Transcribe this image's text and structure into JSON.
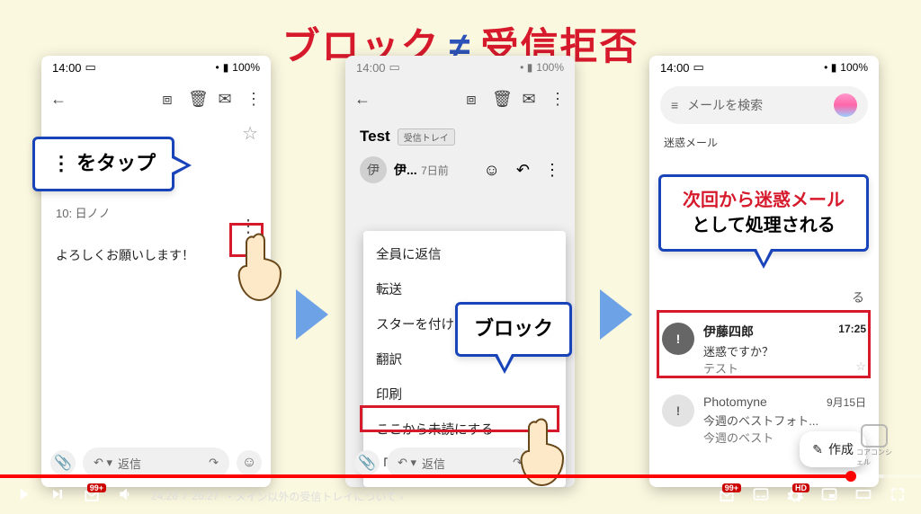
{
  "title": {
    "block": "ブロック",
    "neq": "≠",
    "reject": "受信拒否"
  },
  "statusbar": {
    "time": "14:00",
    "battery": "100%"
  },
  "phone1": {
    "numbered_line": "10: 日ノノ",
    "body_text": "よろしくお願いします！",
    "reply_label": "返信"
  },
  "phone2": {
    "subject": "Test",
    "inbox_label": "受信トレイ",
    "sender_short": "伊...",
    "date": "7日前",
    "menu": {
      "reply_all": "全員に返信",
      "forward": "転送",
      "star": "スターを付ける",
      "translate": "翻訳",
      "print": "印刷",
      "mark_unread": "ここから未読にする",
      "block": "「伊藤四郎」さんをブロック"
    },
    "reply_label": "返信"
  },
  "phone3": {
    "search_placeholder": "メールを検索",
    "folder": "迷惑メール",
    "partial_button_suffix": "る",
    "item1": {
      "sender": "伊藤四郎",
      "time": "17:25",
      "subject": "迷惑ですか？",
      "preview": "テスト"
    },
    "item2": {
      "sender": "Photomyne",
      "time": "9月15日",
      "subject": "今週のベストフォト...",
      "preview": "今週のベスト"
    },
    "compose": "作成"
  },
  "callouts": {
    "c1_prefix": "⋮",
    "c1_suffix": " をタップ",
    "c2": "ブロック",
    "c3_red": "次回から迷惑メール",
    "c3_rest": "として処理される"
  },
  "youtube": {
    "current": "24:28",
    "total": "26:27",
    "chapter": "・メイン以外の受信トレイについて",
    "badge": "99+",
    "hd": "HD"
  },
  "watermark_label": "コアコンシェル"
}
